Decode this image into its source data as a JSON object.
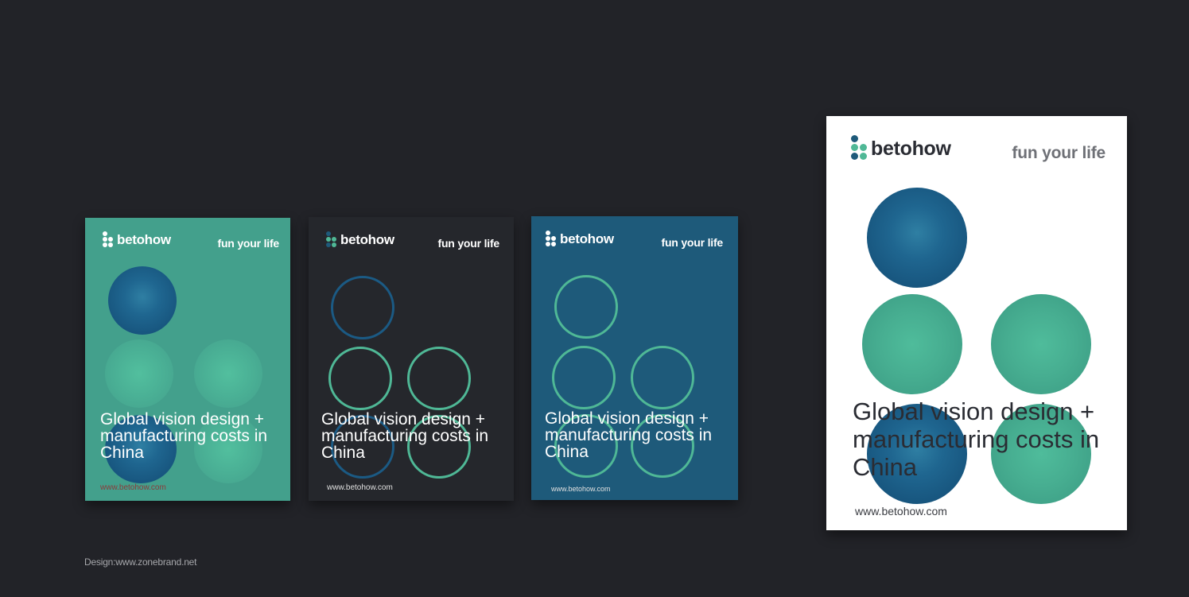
{
  "brand": {
    "name": "betohow",
    "tagline": "fun your life"
  },
  "posters": [
    {
      "headline_lines": [
        "Global vision design +",
        "manufacturing costs in",
        "China"
      ],
      "url": "www.betohow.com"
    },
    {
      "headline_lines": [
        "Global vision design +",
        "manufacturing costs in",
        "China"
      ],
      "url": "www.betohow.com"
    },
    {
      "headline_lines": [
        "Global vision design +",
        "manufacturing costs in",
        "China"
      ],
      "url": "www.betohow.com"
    },
    {
      "headline_lines": [
        "Global vision design +",
        "manufacturing costs in",
        "China"
      ],
      "url": "www.betohow.com"
    }
  ],
  "footer": {
    "credit": "Design:www.zonebrand.net"
  },
  "colors": {
    "background": "#222328",
    "teal": "#43a08c",
    "dark": "#25272c",
    "navy": "#1e5a7a",
    "white": "#ffffff"
  },
  "icons": [
    "logo-dots-icon"
  ]
}
